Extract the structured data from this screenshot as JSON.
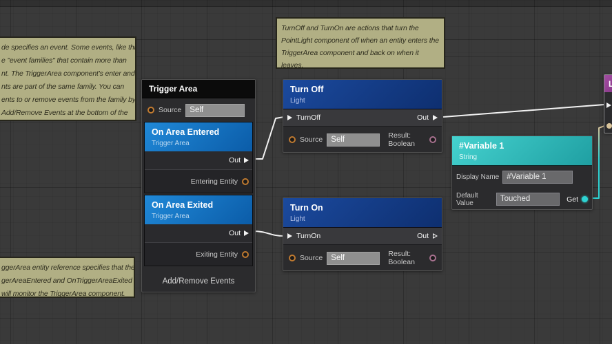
{
  "canvas": {
    "background": "#3a3a3a",
    "grid_minor": "#343434",
    "grid_major": "#2e2e2e",
    "comment_fill": "#b1af84"
  },
  "comments": [
    {
      "lines": [
        "de specifies an event. Some events, like this",
        "e \"event families\" that contain more than",
        "nt. The TriggerArea component's enter and",
        "nts are part of the same family. You can",
        "ents to or remove events from the family by",
        "Add/Remove Events at the bottom of the"
      ]
    },
    {
      "lines": [
        "TurnOff and TurnOn are actions that turn the",
        "PointLight component off when an entity enters the",
        "TriggerArea component and back on when it",
        "leaves."
      ]
    },
    {
      "lines": [
        "ggerArea entity reference specifies that the",
        "gerAreaEntered and OnTriggerAreaExited",
        "will monitor the TriggerArea component."
      ]
    }
  ],
  "nodes": {
    "trigger_area": {
      "title": "Trigger Area",
      "header_color": "#0b0b0b",
      "source_label": "Source",
      "source_value": "Self",
      "events": [
        {
          "title": "On Area Entered",
          "subtitle": "Trigger Area",
          "out_label": "Out",
          "entity_label": "Entering Entity"
        },
        {
          "title": "On Area Exited",
          "subtitle": "Trigger Area",
          "out_label": "Out",
          "entity_label": "Exiting Entity"
        }
      ],
      "footer_label": "Add/Remove Events",
      "event_header_color": "#1580cf"
    },
    "turn_off": {
      "title": "Turn Off",
      "subtitle": "Light",
      "header_color": "#173f8f",
      "exec_in_label": "TurnOff",
      "exec_out_label": "Out",
      "source_label": "Source",
      "source_value": "Self",
      "result_label": "Result: Boolean"
    },
    "turn_on": {
      "title": "Turn On",
      "subtitle": "Light",
      "header_color": "#173f8f",
      "exec_in_label": "TurnOn",
      "exec_out_label": "Out",
      "source_label": "Source",
      "source_value": "Self",
      "result_label": "Result: Boolean"
    },
    "variable": {
      "title": "#Variable 1",
      "subtitle": "String",
      "header_color": "#2fbdbd",
      "display_name_label": "Display Name",
      "display_name_value": "#Variable 1",
      "default_value_label": "Default Value",
      "default_value_value": "Touched",
      "get_label": "Get"
    },
    "clipped_right": {
      "title": "L",
      "header_color": "#8d3c8d"
    }
  },
  "pins": {
    "entity_color": "#c07a30",
    "boolean_color": "#a8718f",
    "string_color": "#2ed3d3",
    "reference_color": "#d8c39a",
    "exec_color": "#f2f2f2"
  }
}
